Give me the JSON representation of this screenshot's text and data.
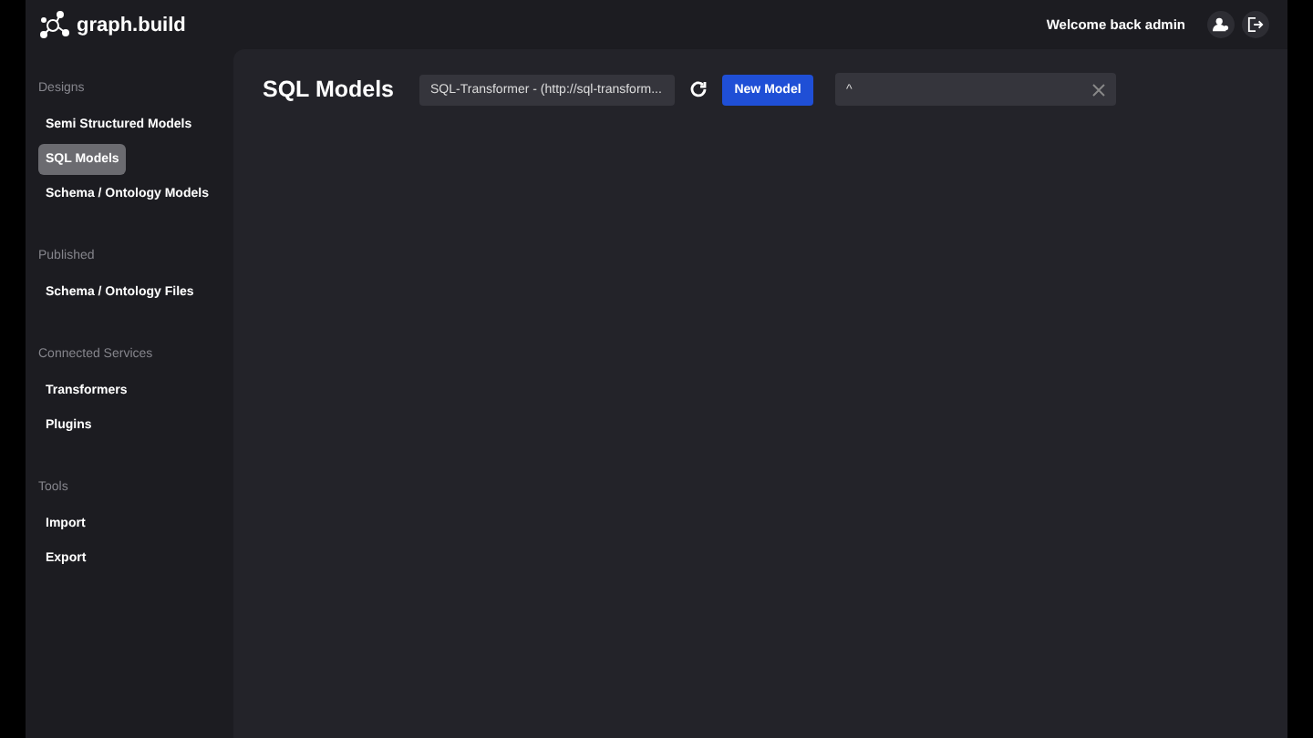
{
  "header": {
    "logo": "graph.build",
    "welcome": "Welcome back admin"
  },
  "sidebar": {
    "sections": [
      {
        "title": "Designs",
        "items": [
          {
            "label": "Semi Structured Models",
            "selected": false
          },
          {
            "label": "SQL Models",
            "selected": true
          },
          {
            "label": "Schema / Ontology Models",
            "selected": false
          }
        ]
      },
      {
        "title": "Published",
        "items": [
          {
            "label": "Schema / Ontology Files",
            "selected": false
          }
        ]
      },
      {
        "title": "Connected Services",
        "items": [
          {
            "label": "Transformers",
            "selected": false
          },
          {
            "label": "Plugins",
            "selected": false
          }
        ]
      },
      {
        "title": "Tools",
        "items": [
          {
            "label": "Import",
            "selected": false
          },
          {
            "label": "Export",
            "selected": false
          }
        ]
      }
    ]
  },
  "main": {
    "title": "SQL Models",
    "transformer_select": {
      "value": "SQL-Transformer - (http://sql-transform..."
    },
    "new_button": "New Model",
    "search": {
      "value": "^"
    }
  }
}
